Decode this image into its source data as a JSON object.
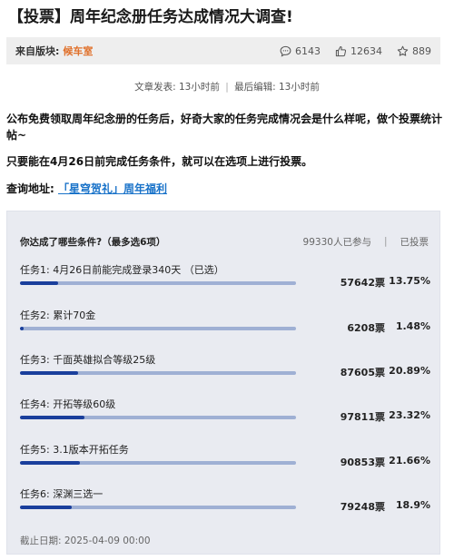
{
  "post": {
    "title": "【投票】周年纪念册任务达成情况大调查!",
    "board_label": "来自版块:",
    "board_name": "候车室",
    "views": "6143",
    "likes": "12634",
    "favorites": "889",
    "published": "文章发表: 13小时前",
    "edited": "最后编辑: 13小时前",
    "para1": "公布免费领取周年纪念册的任务后，好奇大家的任务完成情况会是什么样呢，做个投票统计帖~",
    "para2_pre": "只要能在",
    "para2_bold": "4月26日前",
    "para2_post": "完成任务条件，就可以在选项上进行投票。",
    "query_label": "查询地址:",
    "query_link": "「星穹贺礼」周年福利"
  },
  "poll": {
    "question": "你达成了哪些条件?（最多选6项）",
    "participants": "99330人已参与",
    "separator": "|",
    "status": "已投票",
    "options": [
      {
        "label": "任务1: 4月26日前能完成登录340天 （已选）",
        "votes": "57642票",
        "percent": "13.75%",
        "fraction": 0.1375
      },
      {
        "label": "任务2: 累计70金",
        "votes": "6208票",
        "percent": "1.48%",
        "fraction": 0.0148
      },
      {
        "label": "任务3: 千面英雄拟合等级25级",
        "votes": "87605票",
        "percent": "20.89%",
        "fraction": 0.2089
      },
      {
        "label": "任务4: 开拓等级60级",
        "votes": "97811票",
        "percent": "23.32%",
        "fraction": 0.2332
      },
      {
        "label": "任务5: 3.1版本开拓任务",
        "votes": "90853票",
        "percent": "21.66%",
        "fraction": 0.2166
      },
      {
        "label": "任务6: 深渊三选一",
        "votes": "79248票",
        "percent": "18.9%",
        "fraction": 0.189
      }
    ],
    "deadline": "截止日期: 2025-04-09 00:00"
  },
  "colors": {
    "accent_orange": "#e0702a",
    "link_blue": "#1a73c9",
    "bar_fill": "#1a3f9c",
    "bar_track": "#9fb0d4",
    "poll_bg": "#e9ebf1"
  },
  "icons": [
    "comment-icon",
    "thumbs-up-icon",
    "star-icon"
  ]
}
